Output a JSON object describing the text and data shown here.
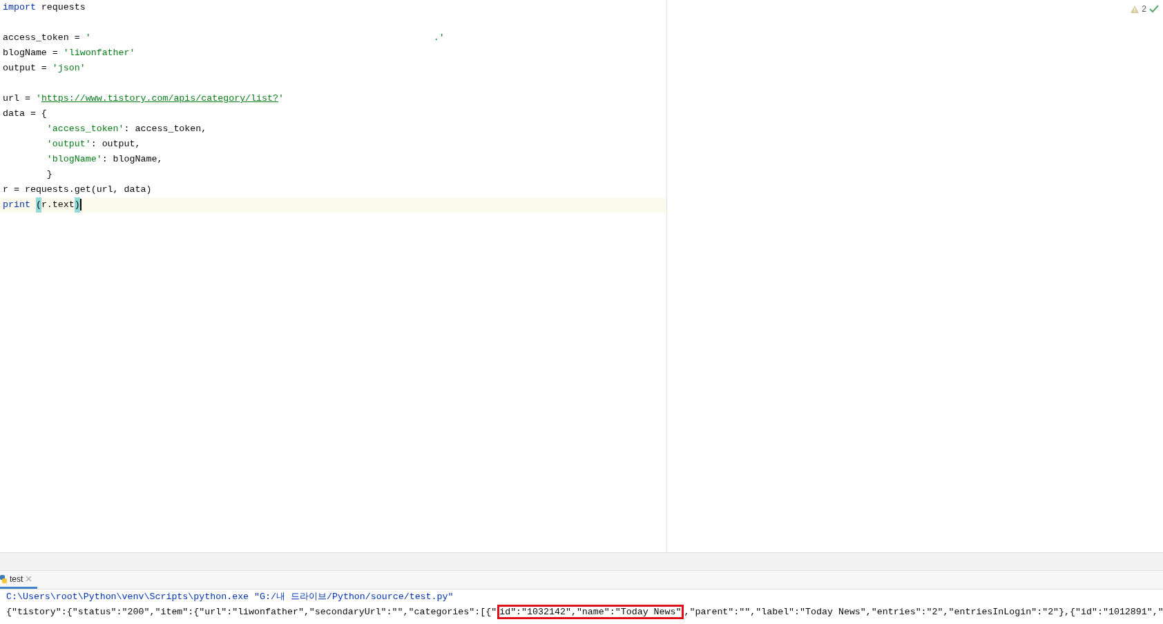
{
  "editor": {
    "inspection": {
      "warnings": "2"
    },
    "lines": [
      {
        "current": false,
        "tokens": [
          {
            "kind": "keyword",
            "text": "import"
          },
          {
            "kind": "plain",
            "text": " requests"
          }
        ]
      },
      {
        "current": false,
        "blank_line_before": true,
        "tokens": [
          {
            "kind": "plain",
            "text": "access_token = "
          },
          {
            "kind": "string",
            "text": "'"
          },
          {
            "kind": "redacted"
          },
          {
            "kind": "string",
            "text": ".'"
          }
        ]
      },
      {
        "current": false,
        "tokens": [
          {
            "kind": "plain",
            "text": "blogName = "
          },
          {
            "kind": "string",
            "text": "'liwonfather'"
          }
        ]
      },
      {
        "current": false,
        "tokens": [
          {
            "kind": "plain",
            "text": "output = "
          },
          {
            "kind": "string",
            "text": "'json'"
          }
        ]
      },
      {
        "current": false,
        "blank_line_before": true,
        "tokens": [
          {
            "kind": "plain",
            "text": "url = "
          },
          {
            "kind": "string",
            "text": "'"
          },
          {
            "kind": "link",
            "text": "https://www.tistory.com/apis/category/list?"
          },
          {
            "kind": "string",
            "text": "'"
          }
        ]
      },
      {
        "current": false,
        "tokens": [
          {
            "kind": "plain",
            "text": "data = {"
          }
        ]
      },
      {
        "current": false,
        "tokens": [
          {
            "kind": "string",
            "text": "        'access_token'"
          },
          {
            "kind": "plain",
            "text": ": access_token,"
          }
        ]
      },
      {
        "current": false,
        "tokens": [
          {
            "kind": "string",
            "text": "        'output'"
          },
          {
            "kind": "plain",
            "text": ": output,"
          }
        ]
      },
      {
        "current": false,
        "tokens": [
          {
            "kind": "string",
            "text": "        'blogName'"
          },
          {
            "kind": "plain",
            "text": ": blogName,"
          }
        ]
      },
      {
        "current": false,
        "tokens": [
          {
            "kind": "plain",
            "text": "        }"
          }
        ]
      },
      {
        "current": false,
        "tokens": [
          {
            "kind": "plain",
            "text": "r = requests.get(url, data)"
          }
        ]
      },
      {
        "current": true,
        "tokens": [
          {
            "kind": "keyword",
            "text": "print "
          },
          {
            "kind": "brace",
            "text": "("
          },
          {
            "kind": "plain",
            "text": "r.text"
          },
          {
            "kind": "brace",
            "text": ")"
          }
        ]
      }
    ]
  },
  "run_panel": {
    "tabs": [
      {
        "label": "test",
        "selected": true
      }
    ],
    "console": [
      {
        "kind": "command",
        "segments": [
          {
            "text": "C:\\Users\\root\\Python\\venv\\Scripts\\python.exe \"G:/내 드라이브/Python/source/test.py\"",
            "boxed": false
          }
        ]
      },
      {
        "kind": "output",
        "segments": [
          {
            "text": "{\"tistory\":{\"status\":\"200\",\"item\":{\"url\":\"liwonfather\",\"secondaryUrl\":\"\",\"categories\":[{\"",
            "boxed": false
          },
          {
            "text": "id\":\"1032142\",\"name\":\"Today News\"",
            "boxed": true
          },
          {
            "text": ",\"parent\":\"\",\"label\":\"Today News\",\"entries\":\"2\",\"entriesInLogin\":\"2\"},{\"id\":\"1012891\",\"",
            "boxed": false
          }
        ]
      }
    ]
  }
}
